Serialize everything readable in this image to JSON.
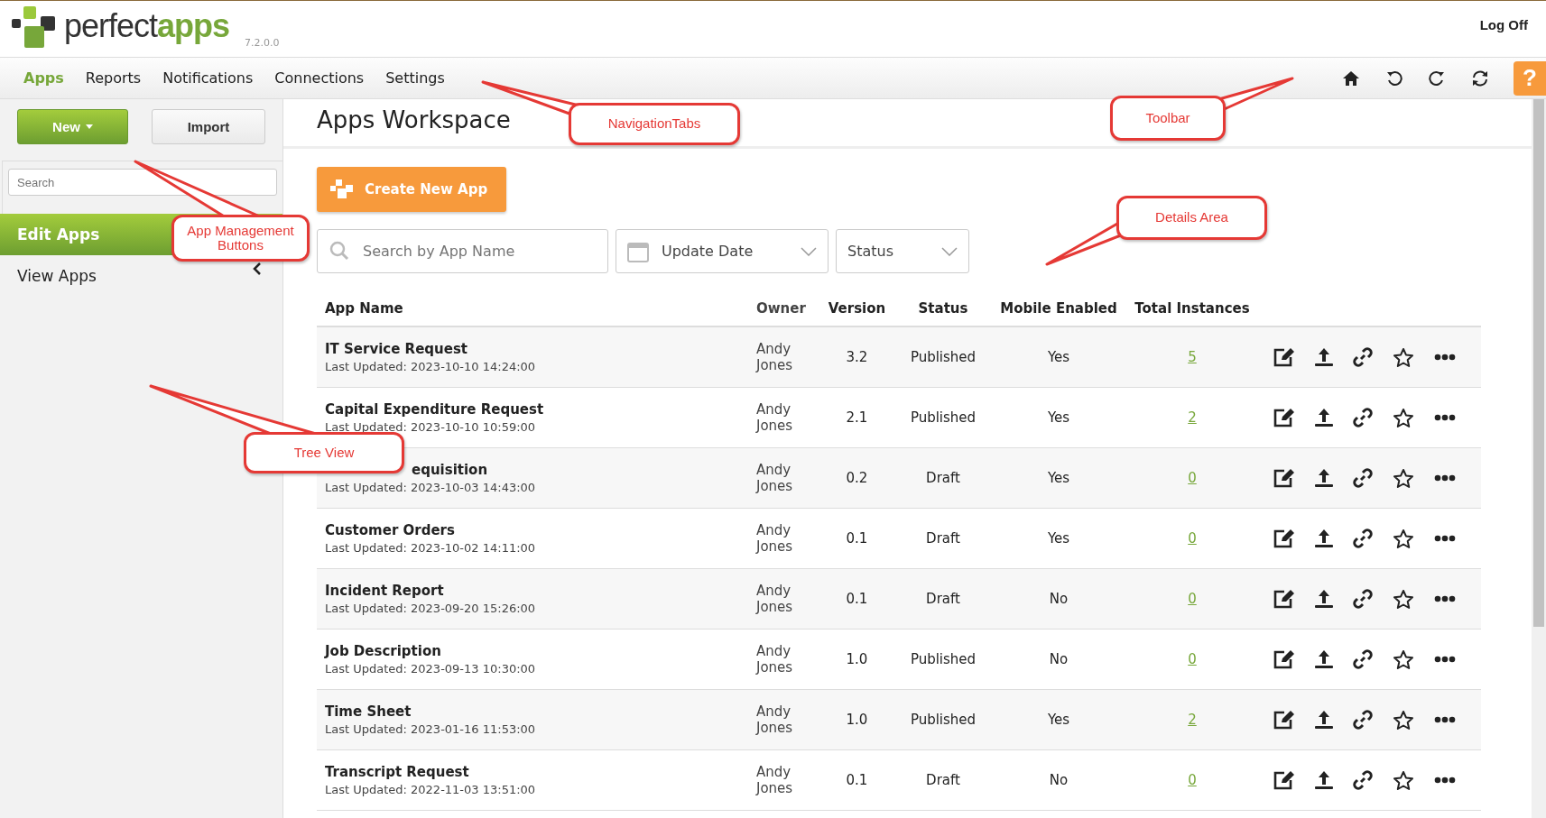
{
  "header": {
    "logo": {
      "word_1": "perfect",
      "word_2": "apps"
    },
    "version": "7.2.0.0",
    "logoff": "Log Off"
  },
  "nav": {
    "tabs": [
      {
        "label": "Apps",
        "selected": true
      },
      {
        "label": "Reports",
        "selected": false
      },
      {
        "label": "Notifications",
        "selected": false
      },
      {
        "label": "Connections",
        "selected": false
      },
      {
        "label": "Settings",
        "selected": false
      }
    ],
    "help": "?"
  },
  "sidebar": {
    "buttons": [
      {
        "label": "New",
        "kind": "primary"
      },
      {
        "label": "Import",
        "kind": "plain"
      }
    ],
    "search": {
      "placeholder": "Search"
    },
    "items": [
      {
        "label": "Edit Apps",
        "selected": true
      },
      {
        "label": "View Apps",
        "selected": false
      }
    ]
  },
  "main": {
    "title": "Apps Workspace",
    "create_button": "Create New App",
    "filters": {
      "search_placeholder": "Search by App Name",
      "date": "Update Date",
      "status": "Status"
    },
    "table": {
      "columns": [
        "App Name",
        "Owner",
        "Version",
        "Status",
        "Mobile Enabled",
        "Total Instances"
      ],
      "rows": [
        {
          "name": "IT Service Request",
          "updated": "Last Updated: 2023-10-10 14:24:00",
          "owner": "Andy Jones",
          "version": "3.2",
          "status": "Published",
          "mobile": "Yes",
          "instances": "5"
        },
        {
          "name": "Capital Expenditure Request",
          "updated": "Last Updated: 2023-10-10 10:59:00",
          "owner": "Andy Jones",
          "version": "2.1",
          "status": "Published",
          "mobile": "Yes",
          "instances": "2"
        },
        {
          "name": "equisition",
          "covered": true,
          "updated": "Last Updated: 2023-10-03 14:43:00",
          "owner": "Andy Jones",
          "version": "0.2",
          "status": "Draft",
          "mobile": "Yes",
          "instances": "0"
        },
        {
          "name": "Customer Orders",
          "updated": "Last Updated: 2023-10-02 14:11:00",
          "owner": "Andy Jones",
          "version": "0.1",
          "status": "Draft",
          "mobile": "Yes",
          "instances": "0"
        },
        {
          "name": "Incident Report",
          "updated": "Last Updated: 2023-09-20 15:26:00",
          "owner": "Andy Jones",
          "version": "0.1",
          "status": "Draft",
          "mobile": "No",
          "instances": "0"
        },
        {
          "name": "Job Description",
          "updated": "Last Updated: 2023-09-13 10:30:00",
          "owner": "Andy Jones",
          "version": "1.0",
          "status": "Published",
          "mobile": "No",
          "instances": "0"
        },
        {
          "name": "Time Sheet",
          "updated": "Last Updated: 2023-01-16 11:53:00",
          "owner": "Andy Jones",
          "version": "1.0",
          "status": "Published",
          "mobile": "Yes",
          "instances": "2"
        },
        {
          "name": "Transcript Request",
          "updated": "Last Updated: 2022-11-03 13:51:00",
          "owner": "Andy Jones",
          "version": "0.1",
          "status": "Draft",
          "mobile": "No",
          "instances": "0"
        }
      ]
    }
  },
  "callouts": [
    {
      "label": "NavigationTabs"
    },
    {
      "label": "Toolbar"
    },
    {
      "label": "Details Area"
    },
    {
      "label": "App Management Buttons"
    },
    {
      "label": "Tree View"
    }
  ]
}
